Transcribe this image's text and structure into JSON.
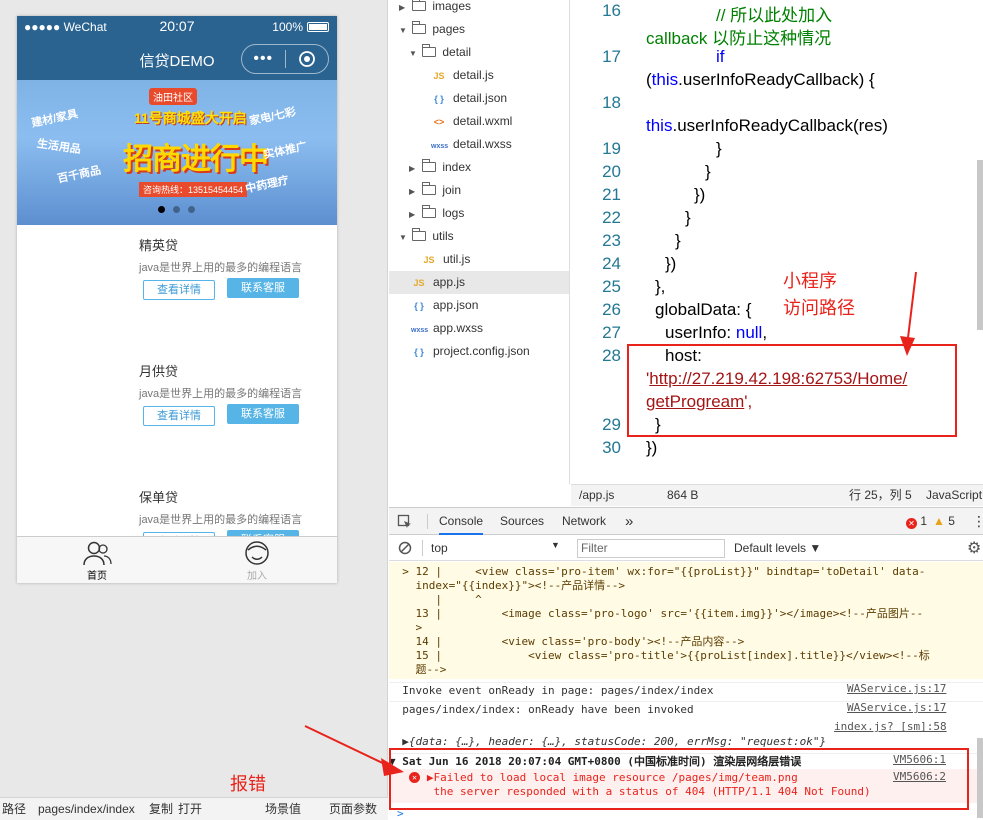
{
  "simulator": {
    "status_bar": {
      "carrier": "●●●●● WeChat",
      "time": "20:07",
      "battery": "100%"
    },
    "nav_title": "信贷DEMO",
    "capsule_dots": "•••",
    "banner": {
      "logo": "油田社区",
      "subtitle": "11号商城盛大开启",
      "headline": "招商进行中",
      "phone": "咨询热线：13515454454",
      "decos": [
        "建材/家具",
        "家电/七彩",
        "百千商品",
        "生活用品",
        "实体推广",
        "中药理疗"
      ]
    },
    "products": [
      {
        "title": "精英贷",
        "desc": "java是世界上用的最多的编程语言",
        "detail_btn": "查看详情",
        "contact_btn": "联系客服"
      },
      {
        "title": "月供贷",
        "desc": "java是世界上用的最多的编程语言",
        "detail_btn": "查看详情",
        "contact_btn": "联系客服"
      },
      {
        "title": "保单贷",
        "desc": "java是世界上用的最多的编程语言",
        "detail_btn": "查看详情",
        "contact_btn": "联系客服"
      }
    ],
    "tabs": [
      {
        "label": "首页",
        "icon": "user-group-icon",
        "active": true
      },
      {
        "label": "加入",
        "icon": "join-icon",
        "active": false
      }
    ],
    "footer": {
      "path_label": "路径",
      "path": "pages/index/index",
      "copy": "复制",
      "open": "打开",
      "scene": "场景值",
      "params": "页面参数"
    }
  },
  "annotations": {
    "error_note": "报错",
    "path_note_line1": "小程序",
    "path_note_line2": "访问路径"
  },
  "file_tree": [
    {
      "name": "images",
      "type": "folder",
      "level": 0,
      "open": false
    },
    {
      "name": "pages",
      "type": "folder",
      "level": 0,
      "open": true
    },
    {
      "name": "detail",
      "type": "folder",
      "level": 1,
      "open": true
    },
    {
      "name": "detail.js",
      "type": "js",
      "level": 2
    },
    {
      "name": "detail.json",
      "type": "json",
      "level": 2
    },
    {
      "name": "detail.wxml",
      "type": "wxml",
      "level": 2
    },
    {
      "name": "detail.wxss",
      "type": "wxss",
      "level": 2
    },
    {
      "name": "index",
      "type": "folder",
      "level": 1,
      "open": false
    },
    {
      "name": "join",
      "type": "folder",
      "level": 1,
      "open": false
    },
    {
      "name": "logs",
      "type": "folder",
      "level": 1,
      "open": false
    },
    {
      "name": "utils",
      "type": "folder",
      "level": 0,
      "open": true
    },
    {
      "name": "util.js",
      "type": "js",
      "level": 1
    },
    {
      "name": "app.js",
      "type": "js",
      "level": 0,
      "selected": true
    },
    {
      "name": "app.json",
      "type": "json",
      "level": 0
    },
    {
      "name": "app.wxss",
      "type": "wxss",
      "level": 0
    },
    {
      "name": "project.config.json",
      "type": "json",
      "level": 0
    }
  ],
  "editor": {
    "line_numbers": [
      "16",
      "17",
      "18",
      "19",
      "20",
      "21",
      "22",
      "23",
      "24",
      "25",
      "26",
      "27",
      "28",
      "29",
      "30"
    ],
    "code": {
      "l16a": "// 所以此处加入",
      "l16b": "callback 以防止这种情况",
      "l17a_kw": "if",
      "l17b_kw": "this",
      "l17b_rest": ".userInfoReadyCallback) {",
      "l18_kw": "this",
      "l18_rest": ".userInfoReadyCallback(res)",
      "l19": "}",
      "l20": "}",
      "l21": "})",
      "l22": "}",
      "l23": "}",
      "l24": "})",
      "l25": "},",
      "l26": "globalData: {",
      "l27a": "userInfo: ",
      "l27_kw": "null",
      "l27b": ",",
      "l28": "host:",
      "host_quote_open": "'",
      "host_url_1": "http://27.219.42.198:62753/Home/",
      "host_url_2": "getProgream",
      "host_quote_close": "',",
      "l29": "}",
      "l30": "})"
    },
    "status": {
      "file": "/app.js",
      "size": "864 B",
      "pos": "行 25，列 5",
      "lang": "JavaScript"
    }
  },
  "devtools": {
    "tabs": [
      "Console",
      "Sources",
      "Network"
    ],
    "more": "»",
    "errors": "1",
    "warnings": "5",
    "context": "top",
    "filter_placeholder": "Filter",
    "levels": "Default levels ▼",
    "lines": {
      "w1": "  > 12 |     <view class='pro-item' wx:for=\"{{proList}}\" bindtap='toDetail' data-",
      "w2": "    index=\"{{index}}\"><!--产品详情-->",
      "w3": "       |     ^",
      "w4": "    13 |         <image class='pro-logo' src='{{item.img}}'></image><!--产品图片--",
      "w5": "    >",
      "w6": "    14 |         <view class='pro-body'><!--产品内容-->",
      "w7": "    15 |             <view class='pro-title'>{{proList[index].title}}</view><!--标",
      "w8": "    题-->",
      "i1": "  Invoke event onReady in page: pages/index/index",
      "i2": "  pages/index/index: onReady have been invoked",
      "i3": "  ▶{data: {…}, header: {…}, statusCode: 200, errMsg: \"request:ok\"}",
      "e_head": "▼ Sat Jun 16 2018 20:07:04 GMT+0800 (中国标准时间) 渲染层网络层错误",
      "e1": "   ▶Failed to load local image resource /pages/img/team.png",
      "e2": "    the server responded with a status of 404 (HTTP/1.1 404 Not Found)",
      "prompt": ">"
    },
    "sources": {
      "s1": "WAService.js:17",
      "s2": "WAService.js:17",
      "s3": "index.js? [sm]:58",
      "s4": "VM5606:1",
      "s5": "VM5606:2"
    }
  },
  "colors": {
    "accent": "#2b6390",
    "error": "#e8231b",
    "link_blue": "#56b4e6"
  }
}
